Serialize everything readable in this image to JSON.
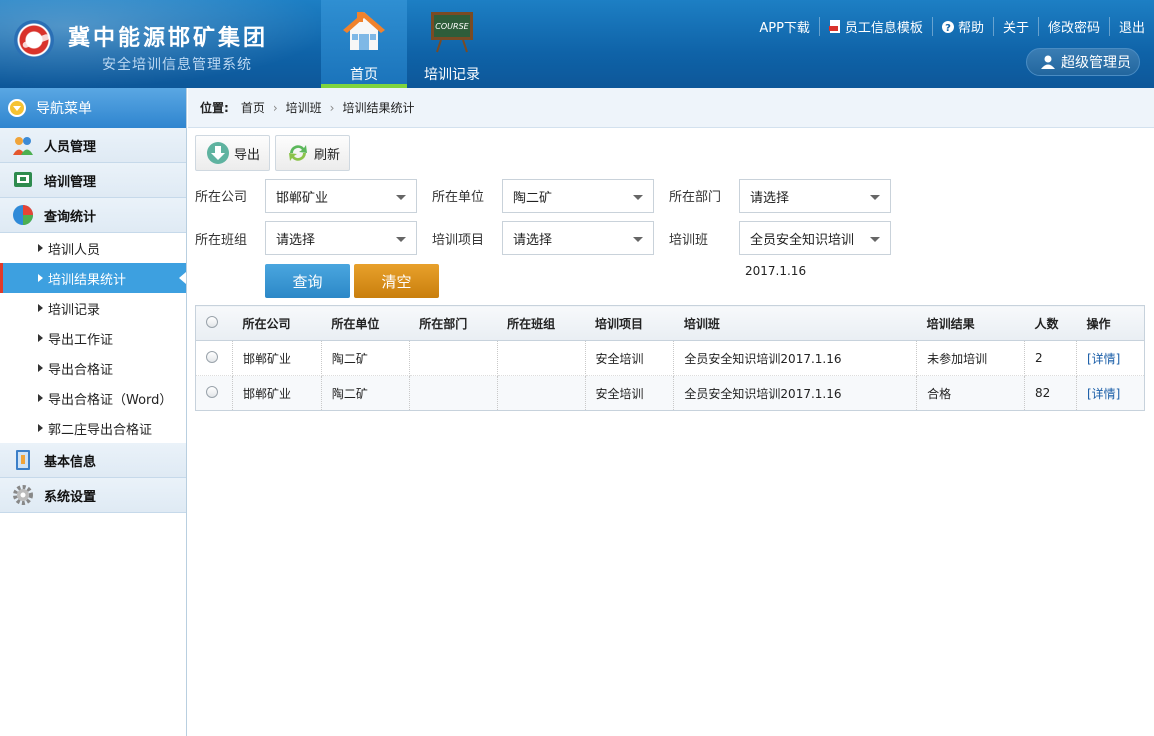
{
  "header": {
    "title": "冀中能源邯矿集团",
    "subtitle": "安全培训信息管理系统",
    "tabs": [
      {
        "label": "首页",
        "icon": "home-icon"
      },
      {
        "label": "培训记录",
        "icon": "course-board-icon",
        "board_text": "COURSE"
      }
    ],
    "links": {
      "app": "APP下载",
      "template": "员工信息模板",
      "help": "帮助",
      "about": "关于",
      "password": "修改密码",
      "logout": "退出"
    },
    "user": "超级管理员"
  },
  "sidebar": {
    "title": "导航菜单",
    "groups": {
      "people": "人员管理",
      "training": "培训管理",
      "query": "查询统计",
      "basic": "基本信息",
      "settings": "系统设置"
    },
    "items": [
      "培训人员",
      "培训结果统计",
      "培训记录",
      "导出工作证",
      "导出合格证",
      "导出合格证（Word）",
      "郭二庄导出合格证"
    ]
  },
  "breadcrumb": {
    "label": "位置:",
    "items": [
      "首页",
      "培训班",
      "培训结果统计"
    ]
  },
  "toolbar": {
    "export": "导出",
    "refresh": "刷新"
  },
  "filters": {
    "company_label": "所在公司",
    "company_value": "邯郸矿业",
    "unit_label": "所在单位",
    "unit_value": "陶二矿",
    "dept_label": "所在部门",
    "dept_value": "请选择",
    "team_label": "所在班组",
    "team_value": "请选择",
    "project_label": "培训项目",
    "project_value": "请选择",
    "class_label": "培训班",
    "class_value": "全员安全知识培训",
    "class_date": "2017.1.16",
    "search": "查询",
    "clear": "清空"
  },
  "table": {
    "headers": [
      "所在公司",
      "所在单位",
      "所在部门",
      "所在班组",
      "培训项目",
      "培训班",
      "培训结果",
      "人数",
      "操作"
    ],
    "rows": [
      [
        "邯郸矿业",
        "陶二矿",
        "",
        "",
        "安全培训",
        "全员安全知识培训2017.1.16",
        "未参加培训",
        "2",
        "[详情]"
      ],
      [
        "邯郸矿业",
        "陶二矿",
        "",
        "",
        "安全培训",
        "全员安全知识培训2017.1.16",
        "合格",
        "82",
        "[详情]"
      ]
    ]
  },
  "colors": {
    "header": "#1670b8",
    "accent": "#3da0e0",
    "clear_button": "#d98e1a",
    "active_marker": "#e03a2a"
  }
}
